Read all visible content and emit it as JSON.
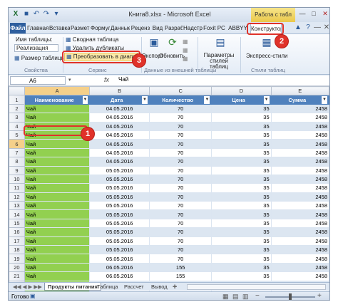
{
  "window": {
    "title": "Книга8.xlsx - Microsoft Excel",
    "context_group": "Работа с табл",
    "quick_access": [
      "save-icon",
      "undo-icon",
      "redo-icon",
      "customize-icon"
    ],
    "controls": [
      "minimize",
      "restore",
      "close"
    ]
  },
  "tabs": [
    "Файл",
    "Главная",
    "Вставка",
    "Разметка",
    "Формула",
    "Данные",
    "Реценз",
    "Вид",
    "Разраб",
    "Надстр",
    "Foxit PC",
    "ABBYY P",
    "Конструктор"
  ],
  "ribbon": {
    "properties": {
      "name_label": "Имя таблицы:",
      "name_value": "Реализация",
      "resize": "Размер таблицы",
      "group": "Свойства"
    },
    "tools": {
      "pivot": "Сводная таблица",
      "remove_dup": "Удалить дубликаты",
      "convert": "Преобразовать в диапазон",
      "group": "Сервис"
    },
    "external": {
      "export": "Экспорт",
      "refresh": "Обновить",
      "group": "Данные из внешней таблицы"
    },
    "style_options": {
      "label": "Параметры стилей таблиц"
    },
    "styles": {
      "express": "Экспресс-стили",
      "group": "Стили таблиц"
    }
  },
  "formula_bar": {
    "cell": "A6",
    "fx": "fx",
    "value": "Чай"
  },
  "grid": {
    "col_letters": [
      "A",
      "B",
      "C",
      "D",
      "E"
    ],
    "headers": [
      "Наименование",
      "Дата",
      "Количество",
      "Цена",
      "Сумма"
    ],
    "rows": [
      [
        "Чай",
        "04.05.2016",
        "70",
        "35",
        "2458"
      ],
      [
        "Чай",
        "04.05.2016",
        "70",
        "35",
        "2458"
      ],
      [
        "Чай",
        "04.05.2016",
        "70",
        "35",
        "2458"
      ],
      [
        "Чай",
        "04.05.2016",
        "70",
        "35",
        "2458"
      ],
      [
        "Чай",
        "04.05.2016",
        "70",
        "35",
        "2458"
      ],
      [
        "Чай",
        "04.05.2016",
        "70",
        "35",
        "2458"
      ],
      [
        "Чай",
        "04.05.2016",
        "70",
        "35",
        "2458"
      ],
      [
        "Чай",
        "05.05.2016",
        "70",
        "35",
        "2458"
      ],
      [
        "Чай",
        "05.05.2016",
        "70",
        "35",
        "2458"
      ],
      [
        "Чай",
        "05.05.2016",
        "70",
        "35",
        "2458"
      ],
      [
        "Чай",
        "05.05.2016",
        "70",
        "35",
        "2458"
      ],
      [
        "Чай",
        "05.05.2016",
        "70",
        "35",
        "2458"
      ],
      [
        "Чай",
        "05.05.2016",
        "70",
        "35",
        "2458"
      ],
      [
        "Чай",
        "05.05.2016",
        "70",
        "35",
        "2458"
      ],
      [
        "Чай",
        "05.05.2016",
        "70",
        "35",
        "2458"
      ],
      [
        "Чай",
        "05.05.2016",
        "70",
        "35",
        "2458"
      ],
      [
        "Чай",
        "05.05.2016",
        "70",
        "35",
        "2458"
      ],
      [
        "Чай",
        "05.05.2016",
        "70",
        "35",
        "2458"
      ],
      [
        "Чай",
        "06.05.2016",
        "155",
        "35",
        "2458"
      ],
      [
        "Чай",
        "06.05.2016",
        "155",
        "35",
        "2458"
      ],
      [
        "Чай",
        "06.05.2016",
        "155",
        "35",
        "2458"
      ],
      [
        "Чай",
        "06.05.2016",
        "155",
        "35",
        "2458"
      ],
      [
        "Чай",
        "06.05.2016",
        "155",
        "35",
        "2458"
      ],
      [
        "Чай",
        "06.05.2016",
        "155",
        "35",
        "2458"
      ]
    ],
    "row_numbers": [
      "1",
      "2",
      "3",
      "4",
      "5",
      "6",
      "7",
      "8",
      "9",
      "10",
      "11",
      "12",
      "13",
      "14",
      "15",
      "16",
      "17",
      "18",
      "19",
      "20",
      "21",
      "22",
      "23",
      "24",
      "25"
    ]
  },
  "sheets": [
    "Продукты питания",
    "Таблица",
    "Рассчет",
    "Вывод"
  ],
  "status": {
    "ready": "Готово"
  },
  "callouts": [
    "1",
    "2",
    "3"
  ],
  "colors": {
    "header": "#4f81bd",
    "column_a": "#92d050",
    "band": "#dce6f1",
    "callout": "#e0322a",
    "file_tab": "#2f5f9e"
  }
}
